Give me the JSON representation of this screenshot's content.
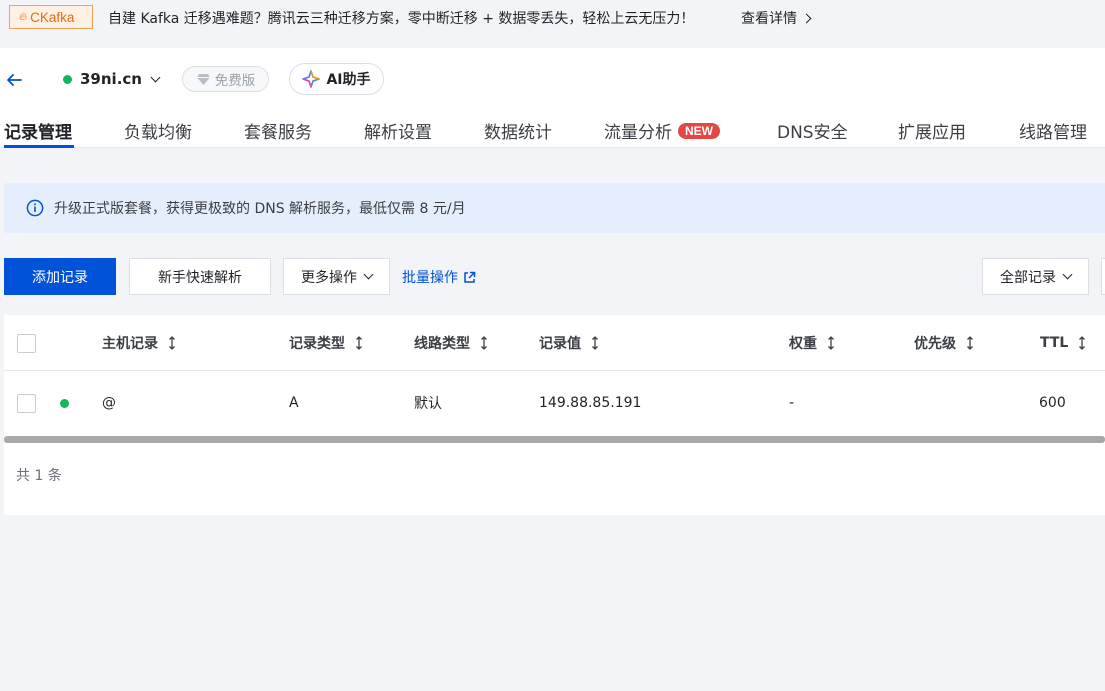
{
  "promo": {
    "tag": "CKafka",
    "text": "自建 Kafka 迁移遇难题？腾讯云三种迁移方案，零中断迁移 + 数据零丢失，轻松上云无压力！",
    "link": "查看详情"
  },
  "header": {
    "domain": "39ni.cn",
    "plan": "免费版",
    "ai_assistant": "AI助手",
    "status_color": "#16b55a"
  },
  "tabs": [
    {
      "label": "记录管理",
      "active": true
    },
    {
      "label": "负载均衡"
    },
    {
      "label": "套餐服务"
    },
    {
      "label": "解析设置"
    },
    {
      "label": "数据统计"
    },
    {
      "label": "流量分析",
      "badge": "NEW"
    },
    {
      "label": "DNS安全"
    },
    {
      "label": "扩展应用"
    },
    {
      "label": "线路管理"
    }
  ],
  "alert": {
    "text": "升级正式版套餐，获得更极致的 DNS 解析服务，最低仅需 8 元/月"
  },
  "toolbar": {
    "add_record": "添加记录",
    "quick_resolve": "新手快速解析",
    "more_actions": "更多操作",
    "batch": "批量操作",
    "filter": "全部记录"
  },
  "table": {
    "columns": [
      "主机记录",
      "记录类型",
      "线路类型",
      "记录值",
      "权重",
      "优先级",
      "TTL"
    ],
    "rows": [
      {
        "host": "@",
        "type": "A",
        "line": "默认",
        "value": "149.88.85.191",
        "weight": "-",
        "priority": "",
        "ttl": "600"
      }
    ],
    "total": "共 1 条"
  },
  "colors": {
    "primary": "#0052d9",
    "badge": "#e54545",
    "alert_bg": "#e5eefd"
  }
}
